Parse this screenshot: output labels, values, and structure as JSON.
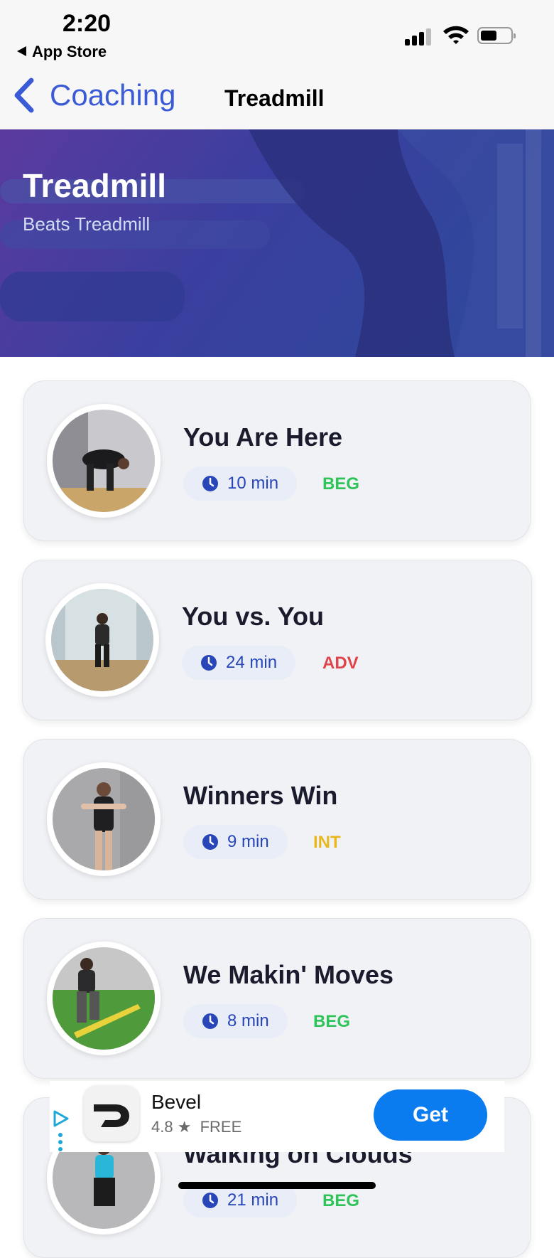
{
  "status_bar": {
    "time": "2:20",
    "back_app": "App Store"
  },
  "nav": {
    "back_label": "Coaching",
    "title": "Treadmill"
  },
  "hero": {
    "title": "Treadmill",
    "subtitle": "Beats Treadmill"
  },
  "workouts": [
    {
      "title": "You Are Here",
      "duration": "10 min",
      "level": "BEG",
      "level_color": "#2ec45a"
    },
    {
      "title": "You vs. You",
      "duration": "24 min",
      "level": "ADV",
      "level_color": "#e0444a"
    },
    {
      "title": "Winners Win",
      "duration": "9 min",
      "level": "INT",
      "level_color": "#e8b820"
    },
    {
      "title": "We Makin' Moves",
      "duration": "8 min",
      "level": "BEG",
      "level_color": "#2ec45a"
    },
    {
      "title": "Walking on Clouds",
      "duration": "21 min",
      "level": "BEG",
      "level_color": "#2ec45a"
    }
  ],
  "ad": {
    "app_name": "Bevel",
    "rating": "4.8",
    "star": "★",
    "price": "FREE",
    "cta": "Get"
  },
  "colors": {
    "accent": "#3b5bd6",
    "pill_text": "#2846b8",
    "get_button": "#0a7cf0"
  }
}
